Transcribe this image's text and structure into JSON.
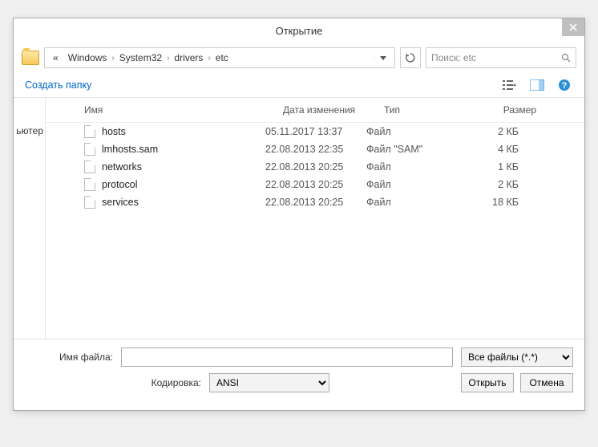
{
  "title": "Открытие",
  "breadcrumbs": {
    "prefix": "«",
    "items": [
      "Windows",
      "System32",
      "drivers",
      "etc"
    ]
  },
  "search": {
    "placeholder": "Поиск: etc"
  },
  "toolbar": {
    "new_folder": "Создать папку"
  },
  "sidebar": {
    "fragment": "ьютер"
  },
  "columns": {
    "name": "Имя",
    "date": "Дата изменения",
    "type": "Тип",
    "size": "Размер"
  },
  "files": [
    {
      "name": "hosts",
      "date": "05.11.2017 13:37",
      "type": "Файл",
      "size": "2 КБ"
    },
    {
      "name": "lmhosts.sam",
      "date": "22.08.2013 22:35",
      "type": "Файл \"SAM\"",
      "size": "4 КБ"
    },
    {
      "name": "networks",
      "date": "22.08.2013 20:25",
      "type": "Файл",
      "size": "1 КБ"
    },
    {
      "name": "protocol",
      "date": "22.08.2013 20:25",
      "type": "Файл",
      "size": "2 КБ"
    },
    {
      "name": "services",
      "date": "22.08.2013 20:25",
      "type": "Файл",
      "size": "18 КБ"
    }
  ],
  "footer": {
    "filename_label": "Имя файла:",
    "filename_value": "",
    "encoding_label": "Кодировка:",
    "encoding_value": "ANSI",
    "filter_value": "Все файлы  (*.*)",
    "open": "Открыть",
    "cancel": "Отмена"
  }
}
